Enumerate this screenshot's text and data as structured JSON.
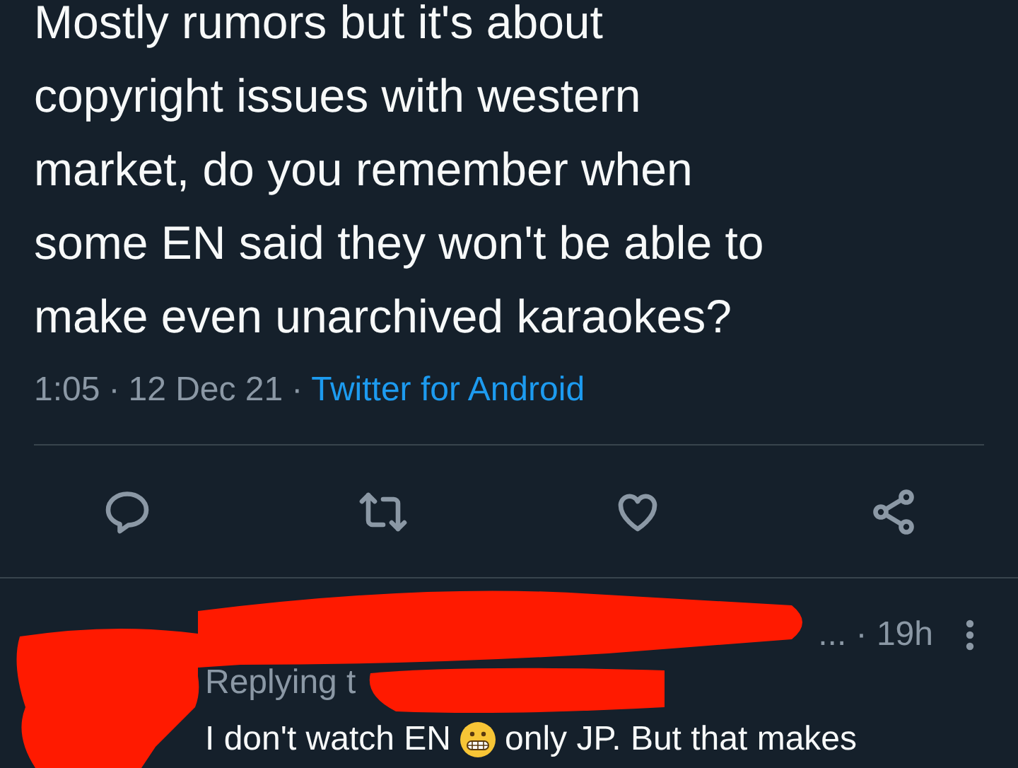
{
  "tweet": {
    "lines": [
      "Mostly rumors but it's about",
      "copyright issues with western",
      "market, do you remember when",
      "some EN said they won't be able to",
      "make even unarchived karaokes?"
    ],
    "time": "1:05",
    "separator": "·",
    "date": "12 Dec 21",
    "source": "Twitter for Android"
  },
  "reply": {
    "meta": "... · 19h",
    "replying": "Replying t",
    "text_before": "I don't watch EN",
    "text_after": "only JP. But that makes"
  }
}
